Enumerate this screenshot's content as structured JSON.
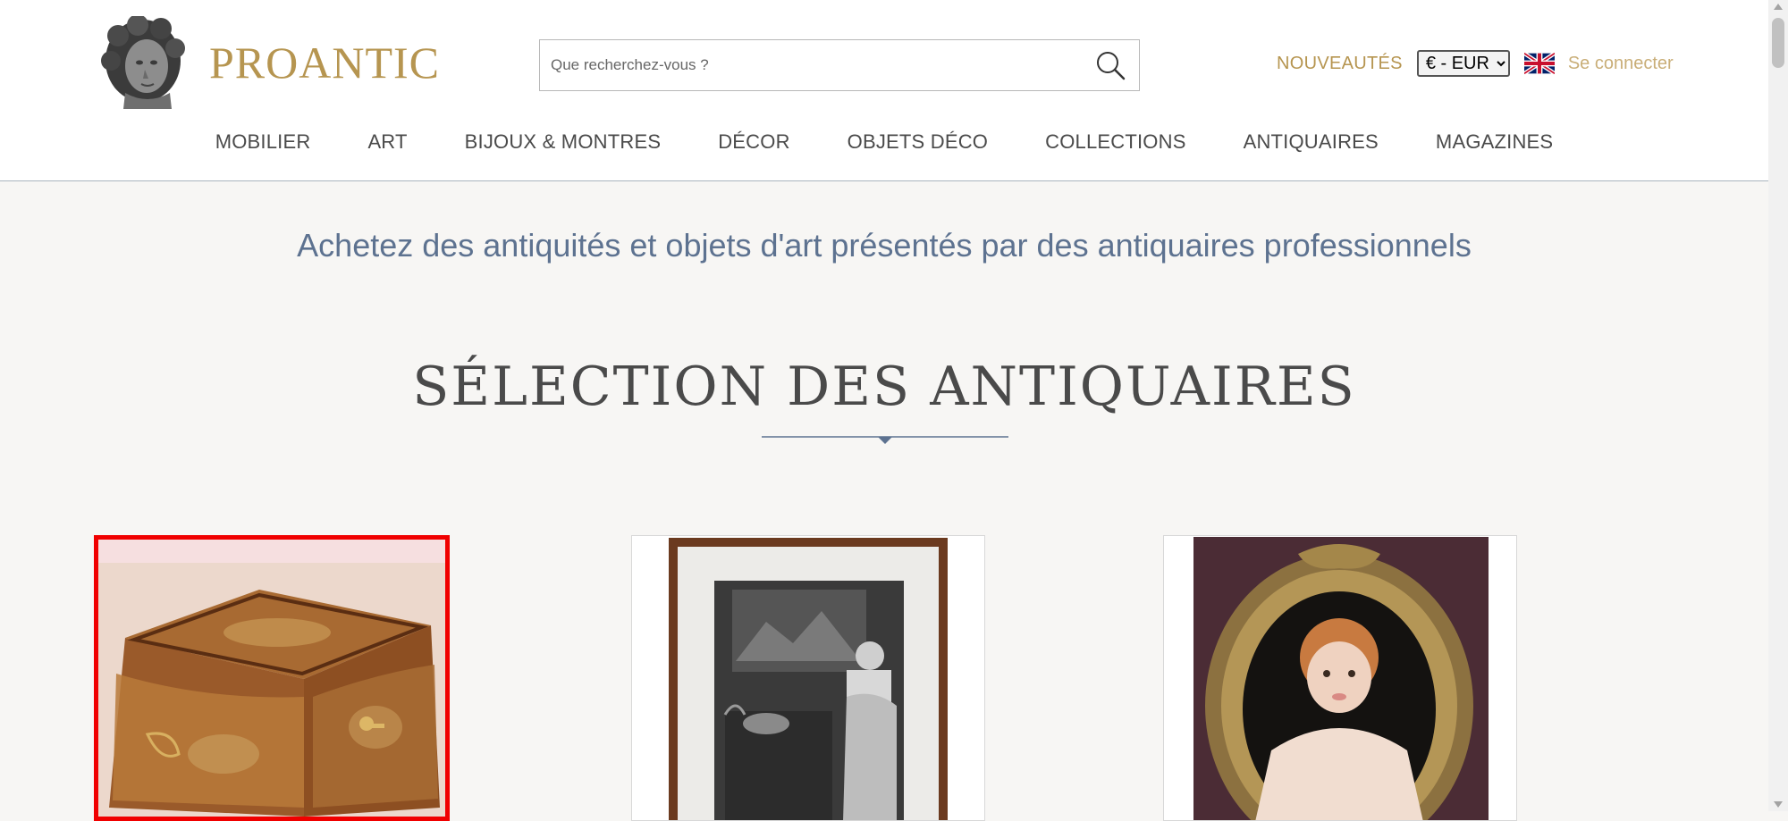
{
  "brand": {
    "name": "PROANTIC",
    "color": "#b69550"
  },
  "search": {
    "placeholder": "Que recherchez-vous ?",
    "icon": "search-icon"
  },
  "header": {
    "new_label": "NOUVEAUTÉS",
    "currency_selected": "€ - EUR",
    "language_icon": "uk-flag-icon",
    "login_label": "Se connecter"
  },
  "nav": {
    "items": [
      {
        "label": "MOBILIER"
      },
      {
        "label": "ART"
      },
      {
        "label": "BIJOUX & MONTRES"
      },
      {
        "label": "DÉCOR"
      },
      {
        "label": "OBJETS DÉCO"
      },
      {
        "label": "COLLECTIONS"
      },
      {
        "label": "ANTIQUAIRES"
      },
      {
        "label": "MAGAZINES"
      }
    ]
  },
  "tagline": "Achetez des antiquités et objets d'art présentés par des antiquaires professionnels",
  "section": {
    "title": "SÉLECTION DES ANTIQUAIRES"
  },
  "products": [
    {
      "image": "marquetry-box-image",
      "selected": true
    },
    {
      "image": "framed-engraving-image",
      "selected": false
    },
    {
      "image": "oval-putto-portrait-image",
      "selected": false
    }
  ],
  "colors": {
    "accent": "#b69550",
    "tagline": "#5d7290",
    "selection": "#f00000"
  }
}
